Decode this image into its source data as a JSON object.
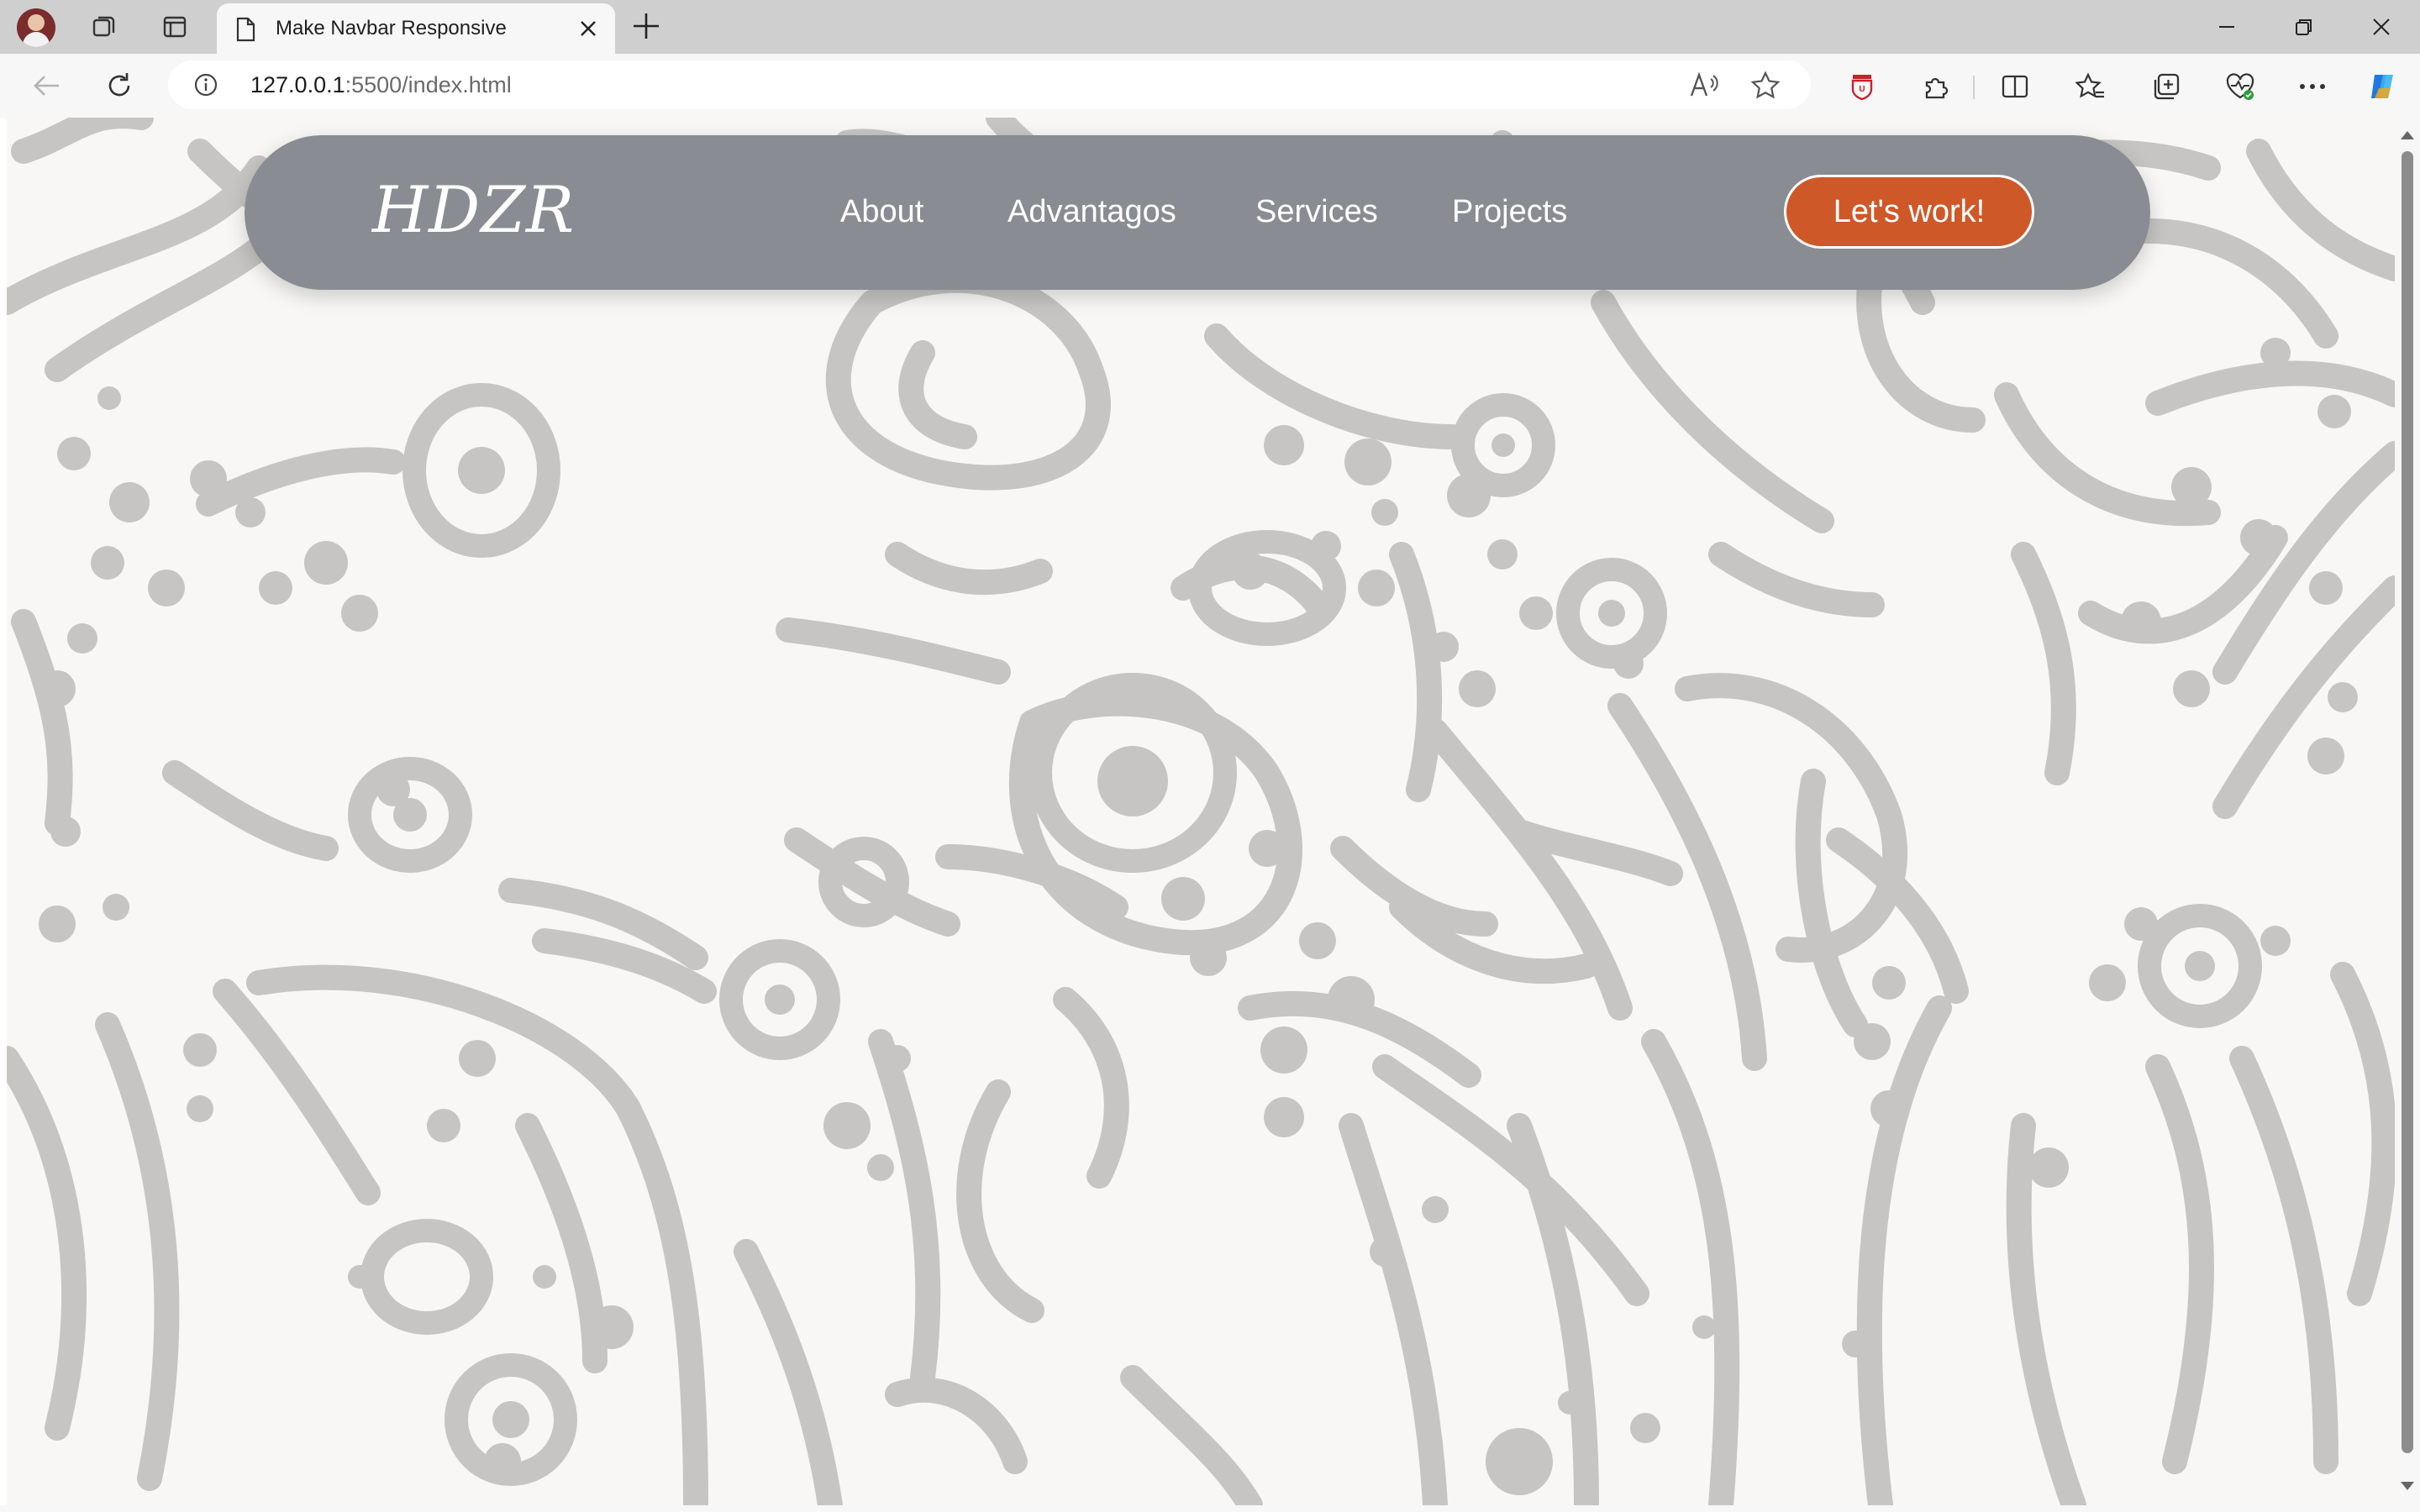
{
  "browser": {
    "tab_title": "Make Navbar Responsive",
    "url_host": "127.0.0.1",
    "url_rest": ":5500/index.html",
    "icons": {
      "avatar": "profile-avatar",
      "workspaces": "workspaces-icon",
      "tab_actions": "vertical-tabs-icon",
      "new_tab": "plus-icon",
      "back": "back-arrow-icon",
      "refresh": "refresh-icon",
      "site_info": "info-icon",
      "read_aloud": "read-aloud-icon",
      "favorite": "star-icon",
      "extensions": [
        "shield-extension-icon",
        "puzzle-extensions-icon",
        "split-screen-icon",
        "favorites-icon",
        "collections-icon",
        "browser-essentials-icon",
        "more-icon",
        "copilot-icon"
      ]
    }
  },
  "page": {
    "navbar": {
      "logo": "HDZR",
      "links": [
        "About",
        "Advantagos",
        "Services",
        "Projects"
      ],
      "cta": "Let's work!"
    },
    "colors": {
      "navbar_bg": "#898c92",
      "cta_bg": "#cf5828",
      "page_bg": "#f8f7f5",
      "pattern": "#c6c5c3"
    }
  }
}
